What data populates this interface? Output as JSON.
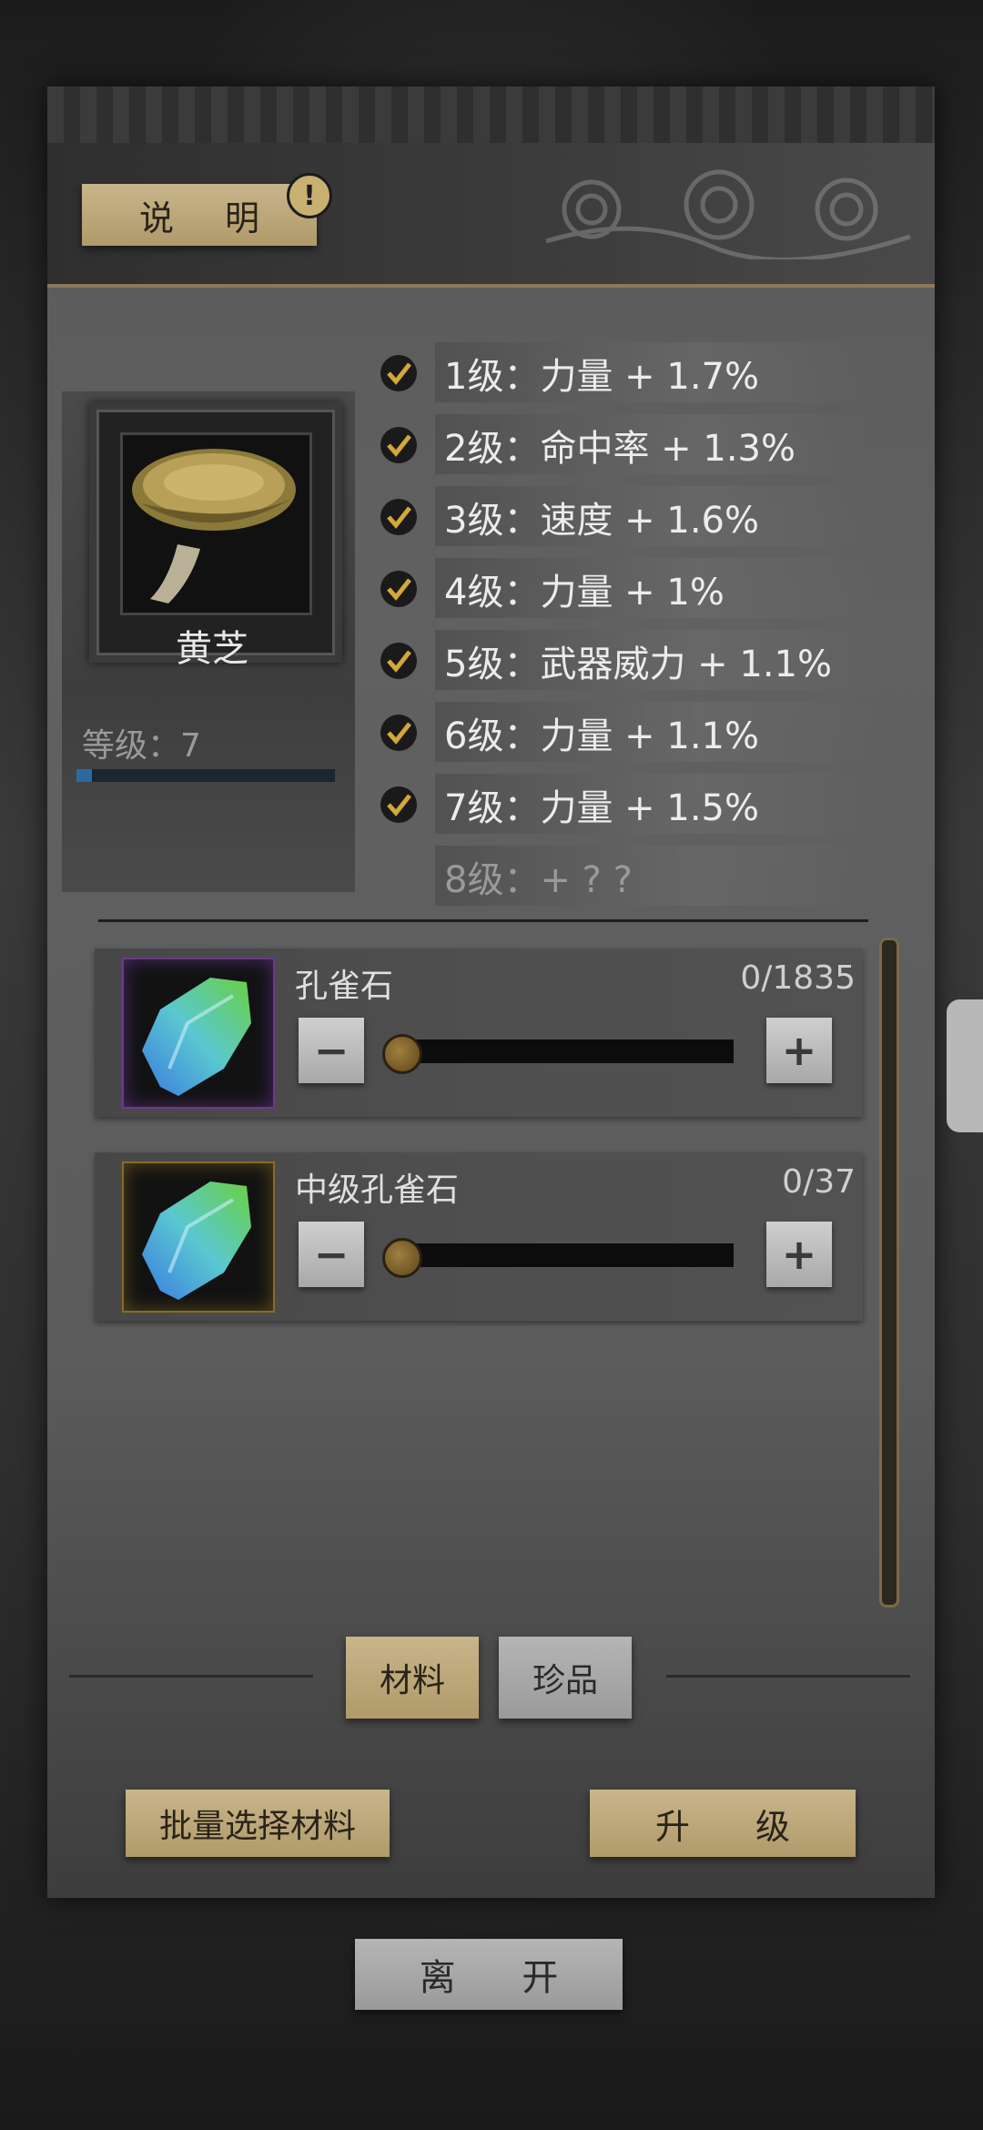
{
  "header": {
    "info_label": "说 明",
    "info_badge": "!"
  },
  "item": {
    "name": "黄芝",
    "level_text": "等级：7",
    "level_progress": 0.06
  },
  "bonuses": [
    {
      "text": "1级：力量 + 1.7%",
      "unlocked": true
    },
    {
      "text": "2级：命中率 + 1.3%",
      "unlocked": true
    },
    {
      "text": "3级：速度 + 1.6%",
      "unlocked": true
    },
    {
      "text": "4级：力量 + 1%",
      "unlocked": true
    },
    {
      "text": "5级：武器威力 + 1.1%",
      "unlocked": true
    },
    {
      "text": "6级：力量 + 1.1%",
      "unlocked": true
    },
    {
      "text": "7级：力量 + 1.5%",
      "unlocked": true
    },
    {
      "text": "8级：+ ? ?",
      "unlocked": false
    }
  ],
  "materials": [
    {
      "name": "孔雀石",
      "count": "0/1835",
      "minus": "−",
      "plus": "+",
      "slider_value": 0
    },
    {
      "name": "中级孔雀石",
      "count": "0/37",
      "minus": "−",
      "plus": "+",
      "slider_value": 0
    }
  ],
  "tabs": {
    "material": "材料",
    "treasure": "珍品"
  },
  "actions": {
    "batch_select": "批量选择材料",
    "upgrade": "升 级",
    "leave": "离 开"
  },
  "colors": {
    "gold_button": "#c8b58a",
    "gray_button": "#b5b5b5",
    "check": "#d4a73a",
    "level_bar": "#2a6aa0"
  }
}
